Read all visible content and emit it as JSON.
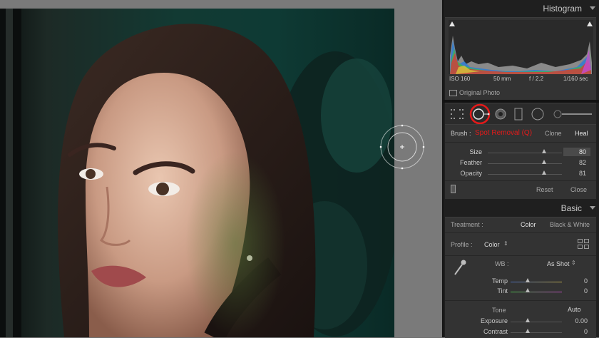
{
  "histogram": {
    "title": "Histogram",
    "iso": "ISO 160",
    "focal": "50 mm",
    "aperture": "f / 2.2",
    "shutter": "1/160 sec",
    "original_photo": "Original Photo"
  },
  "tools": {
    "icons": [
      "crop-overlay-icon",
      "spot-removal-icon",
      "red-eye-icon",
      "graduated-filter-icon",
      "radial-filter-icon",
      "adjustment-brush-icon"
    ],
    "selected": "spot-removal-icon",
    "highlight_color": "#e21a1a"
  },
  "spot": {
    "brush_label": "Brush :",
    "mode_label": "Spot Removal (Q)",
    "clone": "Clone",
    "heal": "Heal",
    "size_label": "Size",
    "size_value": "80",
    "size_level": 0.84,
    "feather_label": "Feather",
    "feather_value": "82",
    "feather_level": 0.84,
    "opacity_label": "Opacity",
    "opacity_value": "81",
    "opacity_level": 0.84,
    "reset": "Reset",
    "close": "Close"
  },
  "basic": {
    "title": "Basic",
    "treatment_label": "Treatment :",
    "color": "Color",
    "bw": "Black & White",
    "profile_label": "Profile :",
    "profile_value": "Color",
    "wb_label": "WB :",
    "wb_value": "As Shot",
    "temp_label": "Temp",
    "temp_value": "0",
    "tint_label": "Tint",
    "tint_value": "0",
    "tone_label": "Tone",
    "auto": "Auto",
    "exposure_label": "Exposure",
    "exposure_value": "0.00",
    "contrast_label": "Contrast",
    "contrast_value": "0"
  }
}
